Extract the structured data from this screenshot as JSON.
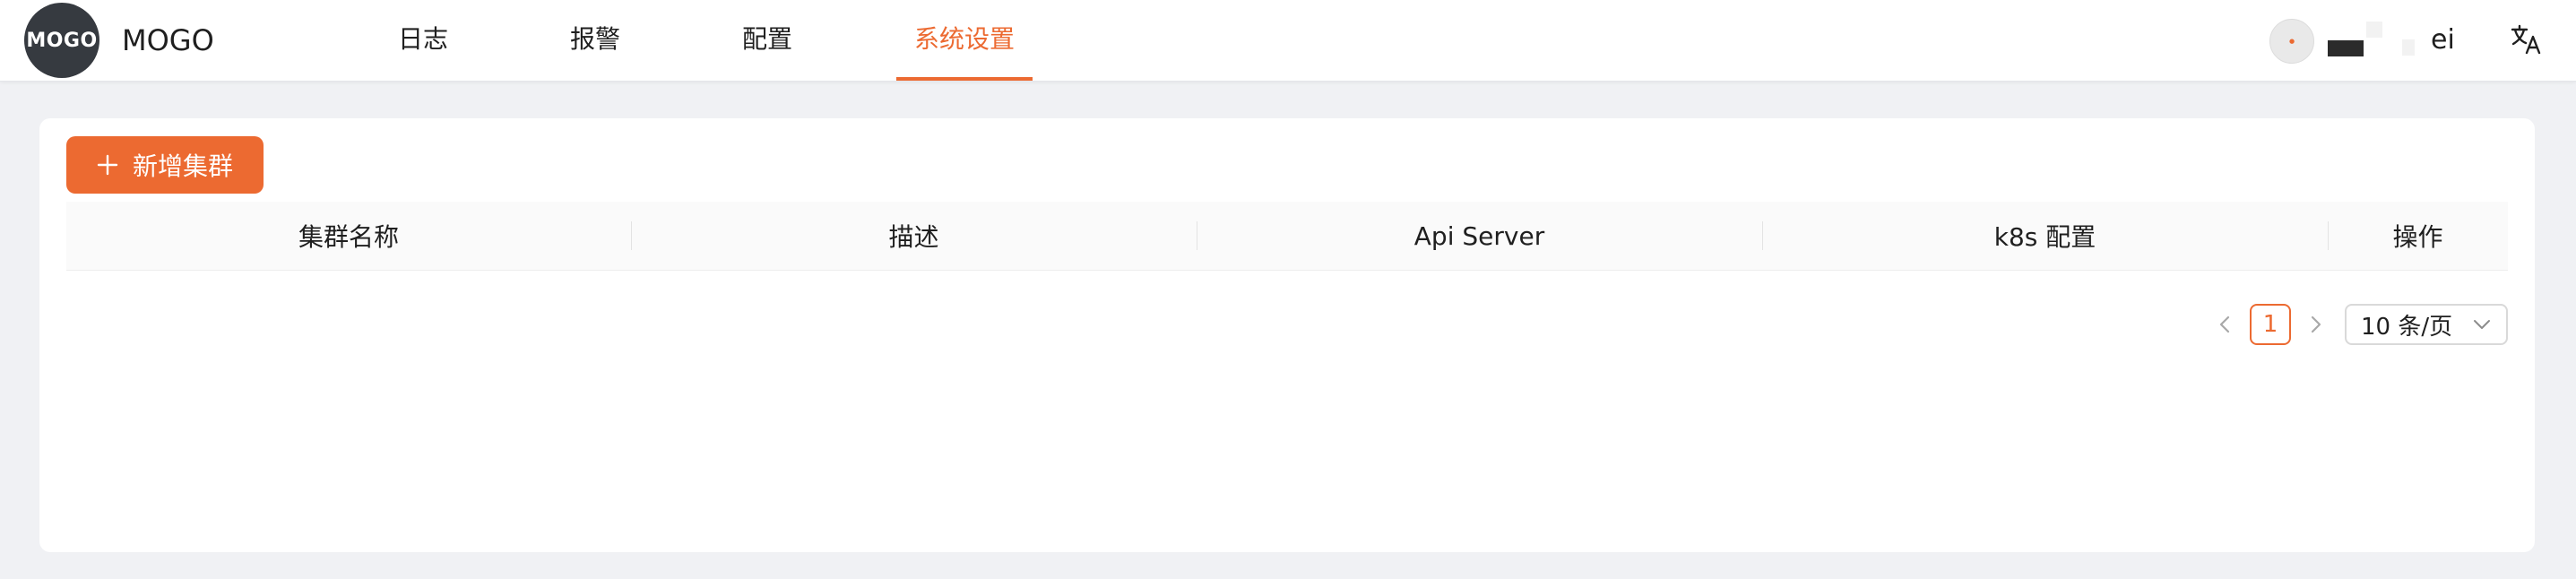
{
  "brand": {
    "logo_text": "MOGO",
    "name": "MOGO"
  },
  "nav": {
    "items": [
      {
        "label": "日志",
        "active": false
      },
      {
        "label": "报警",
        "active": false
      },
      {
        "label": "配置",
        "active": false
      },
      {
        "label": "系统设置",
        "active": true
      }
    ]
  },
  "user": {
    "name_visible": "ei",
    "avatar_icon": "avatar-icon"
  },
  "toolbar": {
    "add_cluster_label": "新增集群"
  },
  "table": {
    "columns": [
      "集群名称",
      "描述",
      "Api Server",
      "k8s 配置",
      "操作"
    ],
    "rows": []
  },
  "pagination": {
    "current_page": "1",
    "page_size": "10 条/页"
  },
  "colors": {
    "accent": "#ec6a31",
    "background": "#f0f1f4",
    "card": "#ffffff"
  }
}
